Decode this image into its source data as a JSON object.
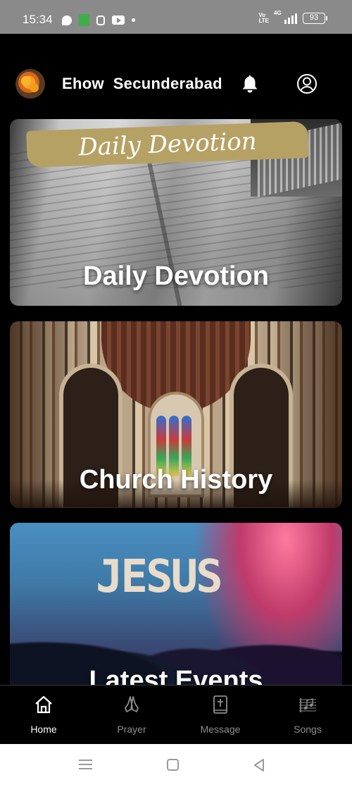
{
  "status_bar": {
    "time": "15:34",
    "network_label": "4G",
    "volte_label": "Vo\nLTE",
    "battery_level": "93"
  },
  "header": {
    "title": "Ehow  Secunderabad",
    "icons": {
      "notifications": "bell-icon",
      "account": "account-circle-icon"
    }
  },
  "cards": [
    {
      "title": "Daily Devotion",
      "banner_text": "Daily Devotion"
    },
    {
      "title": "Church History"
    },
    {
      "title": "Latest Events",
      "image_text": "JESUS"
    }
  ],
  "bottom_nav": {
    "items": [
      {
        "label": "Home",
        "icon": "home-icon",
        "active": true
      },
      {
        "label": "Prayer",
        "icon": "praying-hands-icon",
        "active": false
      },
      {
        "label": "Message",
        "icon": "bible-icon",
        "active": false
      },
      {
        "label": "Songs",
        "icon": "music-sheet-icon",
        "active": false
      }
    ]
  },
  "colors": {
    "background": "#000000",
    "status_bar": "#8a8a8a",
    "nav_active": "#ffffff",
    "nav_inactive": "#8e8e8e",
    "banner": "#b6a165"
  }
}
